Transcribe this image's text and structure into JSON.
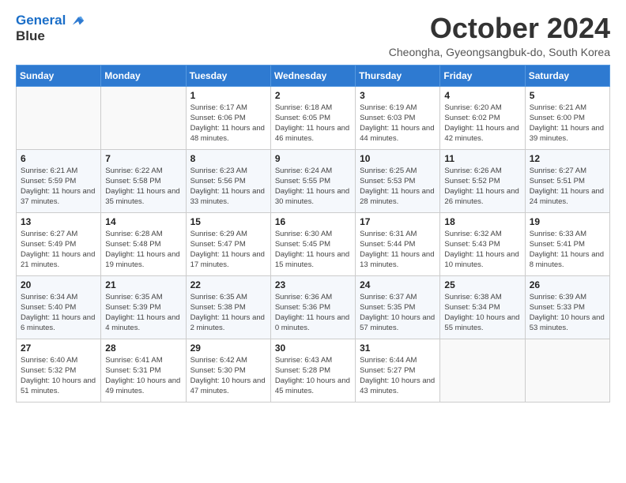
{
  "header": {
    "logo_line1": "General",
    "logo_line2": "Blue",
    "month_title": "October 2024",
    "subtitle": "Cheongha, Gyeongsangbuk-do, South Korea"
  },
  "weekdays": [
    "Sunday",
    "Monday",
    "Tuesday",
    "Wednesday",
    "Thursday",
    "Friday",
    "Saturday"
  ],
  "weeks": [
    [
      null,
      null,
      {
        "day": "1",
        "sunrise": "Sunrise: 6:17 AM",
        "sunset": "Sunset: 6:06 PM",
        "daylight": "Daylight: 11 hours and 48 minutes."
      },
      {
        "day": "2",
        "sunrise": "Sunrise: 6:18 AM",
        "sunset": "Sunset: 6:05 PM",
        "daylight": "Daylight: 11 hours and 46 minutes."
      },
      {
        "day": "3",
        "sunrise": "Sunrise: 6:19 AM",
        "sunset": "Sunset: 6:03 PM",
        "daylight": "Daylight: 11 hours and 44 minutes."
      },
      {
        "day": "4",
        "sunrise": "Sunrise: 6:20 AM",
        "sunset": "Sunset: 6:02 PM",
        "daylight": "Daylight: 11 hours and 42 minutes."
      },
      {
        "day": "5",
        "sunrise": "Sunrise: 6:21 AM",
        "sunset": "Sunset: 6:00 PM",
        "daylight": "Daylight: 11 hours and 39 minutes."
      }
    ],
    [
      {
        "day": "6",
        "sunrise": "Sunrise: 6:21 AM",
        "sunset": "Sunset: 5:59 PM",
        "daylight": "Daylight: 11 hours and 37 minutes."
      },
      {
        "day": "7",
        "sunrise": "Sunrise: 6:22 AM",
        "sunset": "Sunset: 5:58 PM",
        "daylight": "Daylight: 11 hours and 35 minutes."
      },
      {
        "day": "8",
        "sunrise": "Sunrise: 6:23 AM",
        "sunset": "Sunset: 5:56 PM",
        "daylight": "Daylight: 11 hours and 33 minutes."
      },
      {
        "day": "9",
        "sunrise": "Sunrise: 6:24 AM",
        "sunset": "Sunset: 5:55 PM",
        "daylight": "Daylight: 11 hours and 30 minutes."
      },
      {
        "day": "10",
        "sunrise": "Sunrise: 6:25 AM",
        "sunset": "Sunset: 5:53 PM",
        "daylight": "Daylight: 11 hours and 28 minutes."
      },
      {
        "day": "11",
        "sunrise": "Sunrise: 6:26 AM",
        "sunset": "Sunset: 5:52 PM",
        "daylight": "Daylight: 11 hours and 26 minutes."
      },
      {
        "day": "12",
        "sunrise": "Sunrise: 6:27 AM",
        "sunset": "Sunset: 5:51 PM",
        "daylight": "Daylight: 11 hours and 24 minutes."
      }
    ],
    [
      {
        "day": "13",
        "sunrise": "Sunrise: 6:27 AM",
        "sunset": "Sunset: 5:49 PM",
        "daylight": "Daylight: 11 hours and 21 minutes."
      },
      {
        "day": "14",
        "sunrise": "Sunrise: 6:28 AM",
        "sunset": "Sunset: 5:48 PM",
        "daylight": "Daylight: 11 hours and 19 minutes."
      },
      {
        "day": "15",
        "sunrise": "Sunrise: 6:29 AM",
        "sunset": "Sunset: 5:47 PM",
        "daylight": "Daylight: 11 hours and 17 minutes."
      },
      {
        "day": "16",
        "sunrise": "Sunrise: 6:30 AM",
        "sunset": "Sunset: 5:45 PM",
        "daylight": "Daylight: 11 hours and 15 minutes."
      },
      {
        "day": "17",
        "sunrise": "Sunrise: 6:31 AM",
        "sunset": "Sunset: 5:44 PM",
        "daylight": "Daylight: 11 hours and 13 minutes."
      },
      {
        "day": "18",
        "sunrise": "Sunrise: 6:32 AM",
        "sunset": "Sunset: 5:43 PM",
        "daylight": "Daylight: 11 hours and 10 minutes."
      },
      {
        "day": "19",
        "sunrise": "Sunrise: 6:33 AM",
        "sunset": "Sunset: 5:41 PM",
        "daylight": "Daylight: 11 hours and 8 minutes."
      }
    ],
    [
      {
        "day": "20",
        "sunrise": "Sunrise: 6:34 AM",
        "sunset": "Sunset: 5:40 PM",
        "daylight": "Daylight: 11 hours and 6 minutes."
      },
      {
        "day": "21",
        "sunrise": "Sunrise: 6:35 AM",
        "sunset": "Sunset: 5:39 PM",
        "daylight": "Daylight: 11 hours and 4 minutes."
      },
      {
        "day": "22",
        "sunrise": "Sunrise: 6:35 AM",
        "sunset": "Sunset: 5:38 PM",
        "daylight": "Daylight: 11 hours and 2 minutes."
      },
      {
        "day": "23",
        "sunrise": "Sunrise: 6:36 AM",
        "sunset": "Sunset: 5:36 PM",
        "daylight": "Daylight: 11 hours and 0 minutes."
      },
      {
        "day": "24",
        "sunrise": "Sunrise: 6:37 AM",
        "sunset": "Sunset: 5:35 PM",
        "daylight": "Daylight: 10 hours and 57 minutes."
      },
      {
        "day": "25",
        "sunrise": "Sunrise: 6:38 AM",
        "sunset": "Sunset: 5:34 PM",
        "daylight": "Daylight: 10 hours and 55 minutes."
      },
      {
        "day": "26",
        "sunrise": "Sunrise: 6:39 AM",
        "sunset": "Sunset: 5:33 PM",
        "daylight": "Daylight: 10 hours and 53 minutes."
      }
    ],
    [
      {
        "day": "27",
        "sunrise": "Sunrise: 6:40 AM",
        "sunset": "Sunset: 5:32 PM",
        "daylight": "Daylight: 10 hours and 51 minutes."
      },
      {
        "day": "28",
        "sunrise": "Sunrise: 6:41 AM",
        "sunset": "Sunset: 5:31 PM",
        "daylight": "Daylight: 10 hours and 49 minutes."
      },
      {
        "day": "29",
        "sunrise": "Sunrise: 6:42 AM",
        "sunset": "Sunset: 5:30 PM",
        "daylight": "Daylight: 10 hours and 47 minutes."
      },
      {
        "day": "30",
        "sunrise": "Sunrise: 6:43 AM",
        "sunset": "Sunset: 5:28 PM",
        "daylight": "Daylight: 10 hours and 45 minutes."
      },
      {
        "day": "31",
        "sunrise": "Sunrise: 6:44 AM",
        "sunset": "Sunset: 5:27 PM",
        "daylight": "Daylight: 10 hours and 43 minutes."
      },
      null,
      null
    ]
  ]
}
